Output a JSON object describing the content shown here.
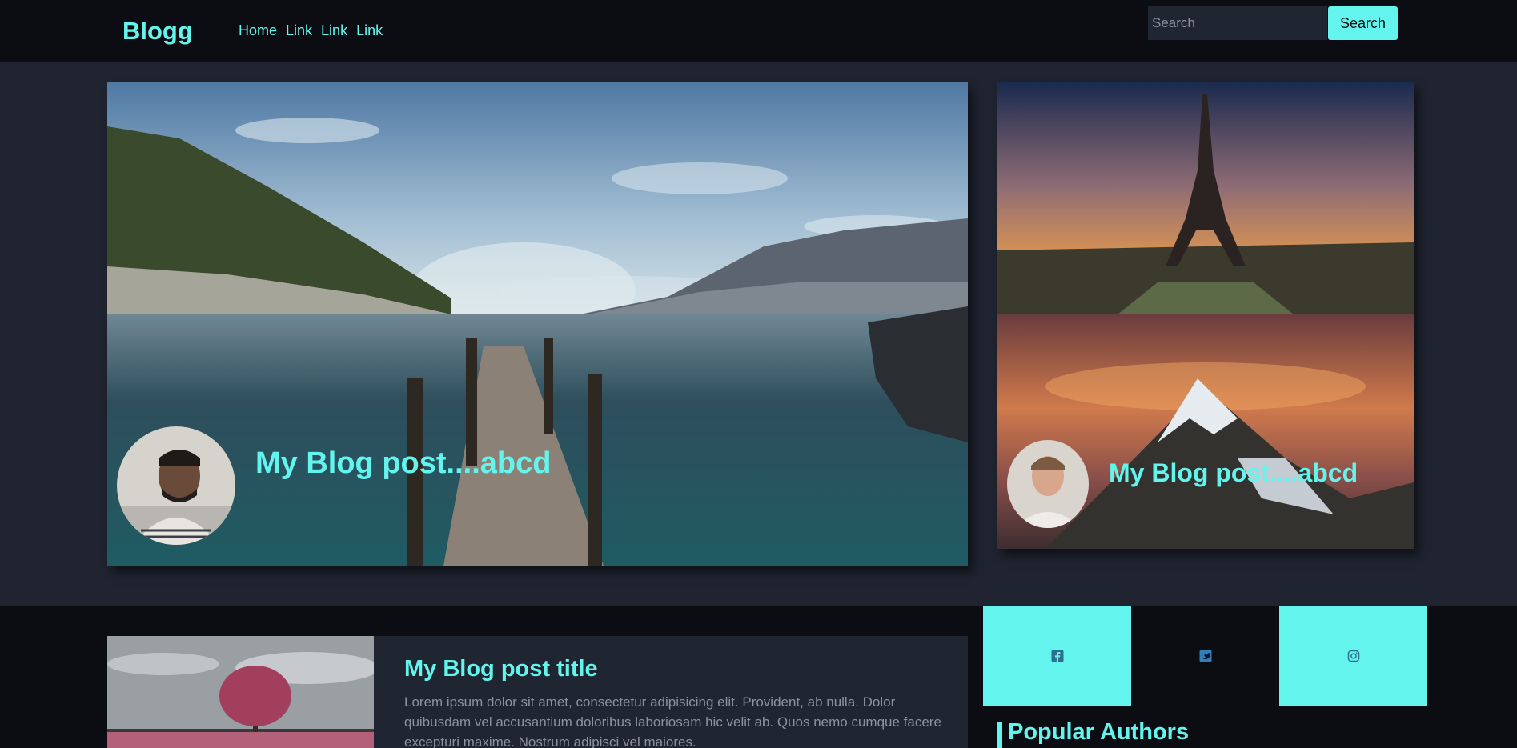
{
  "navbar": {
    "brand": "Blogg",
    "links": [
      "Home",
      "Link",
      "Link",
      "Link"
    ],
    "search_placeholder": "Search",
    "search_button": "Search"
  },
  "hero": {
    "main_post_title": "My Blog post....abcd",
    "side_post_title": "My Blog post....abcd"
  },
  "featured_card": {
    "title": "My Blog post title",
    "excerpt": "Lorem ipsum dolor sit amet, consectetur adipisicing elit. Provident, ab nulla. Dolor quibusdam vel accusantium doloribus laboriosam hic velit ab. Quos nemo cumque facere excepturi maxime. Nostrum adipisci vel maiores."
  },
  "social": {
    "icons": [
      "facebook-icon",
      "twitter-icon",
      "instagram-icon"
    ]
  },
  "sidebar": {
    "popular_title": "Popular Authors"
  },
  "colors": {
    "accent": "#63f5ed",
    "navbar_bg": "#0b0d12",
    "page_bg": "#1f2430",
    "card_bg": "#202631"
  }
}
